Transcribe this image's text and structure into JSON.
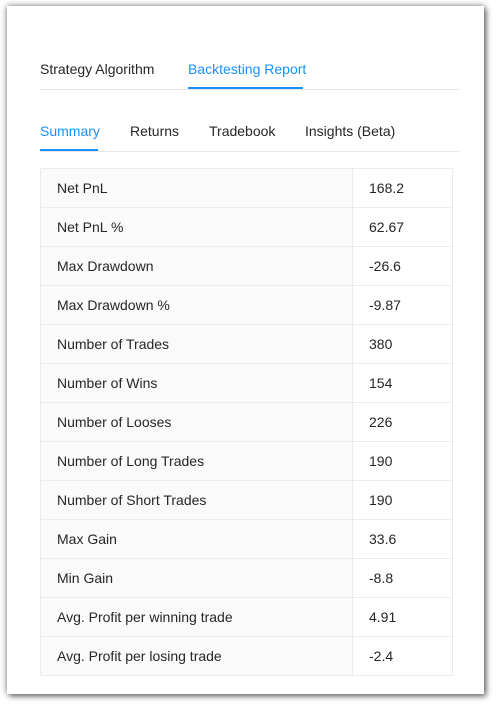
{
  "primary_tabs": [
    {
      "label": "Strategy Algorithm",
      "active": false
    },
    {
      "label": "Backtesting Report",
      "active": true
    }
  ],
  "secondary_tabs": [
    {
      "label": "Summary",
      "active": true
    },
    {
      "label": "Returns",
      "active": false
    },
    {
      "label": "Tradebook",
      "active": false
    },
    {
      "label": "Insights (Beta)",
      "active": false
    }
  ],
  "summary": {
    "rows": [
      {
        "label": "Net PnL",
        "value": "168.2"
      },
      {
        "label": "Net PnL %",
        "value": "62.67"
      },
      {
        "label": "Max Drawdown",
        "value": "-26.6"
      },
      {
        "label": "Max Drawdown %",
        "value": "-9.87"
      },
      {
        "label": "Number of Trades",
        "value": "380"
      },
      {
        "label": "Number of Wins",
        "value": "154"
      },
      {
        "label": "Number of Looses",
        "value": "226"
      },
      {
        "label": "Number of Long Trades",
        "value": "190"
      },
      {
        "label": "Number of Short Trades",
        "value": "190"
      },
      {
        "label": "Max Gain",
        "value": "33.6"
      },
      {
        "label": "Min Gain",
        "value": "-8.8"
      },
      {
        "label": "Avg. Profit per winning trade",
        "value": "4.91"
      },
      {
        "label": "Avg. Profit per losing trade",
        "value": "-2.4"
      }
    ]
  },
  "colors": {
    "accent": "#1890ff",
    "text": "#262626",
    "label_cell_bg": "#fafafa",
    "border": "#ebebeb"
  }
}
